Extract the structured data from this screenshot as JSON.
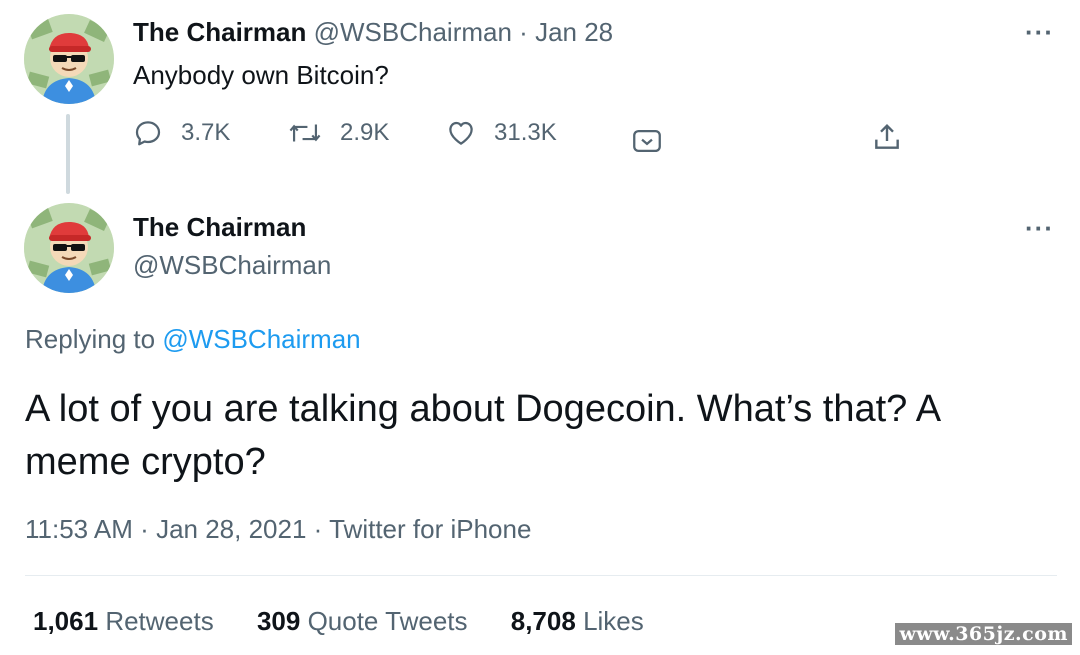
{
  "tweet1": {
    "display_name": "The Chairman",
    "handle": "@WSBChairman",
    "separator": "·",
    "date": "Jan 28",
    "text": "Anybody own Bitcoin?",
    "replies": "3.7K",
    "retweets": "2.9K",
    "likes": "31.3K",
    "icons": [
      "reply-icon",
      "retweet-icon",
      "like-icon",
      "tip-jar-icon",
      "share-icon",
      "more-icon"
    ]
  },
  "tweet2": {
    "display_name": "The Chairman",
    "handle": "@WSBChairman",
    "replying_prefix": "Replying to",
    "replying_handle": "@WSBChairman",
    "text": "A lot of you are talking about Dogecoin. What’s that? A meme crypto?",
    "time": "11:53 AM",
    "date": "Jan 28, 2021",
    "source": "Twitter for iPhone",
    "separator": "·",
    "stats": {
      "retweets_count": "1,061",
      "retweets_label": "Retweets",
      "quotes_count": "309",
      "quotes_label": "Quote Tweets",
      "likes_count": "8,708",
      "likes_label": "Likes"
    }
  },
  "more_glyph": "···",
  "watermark": "www.365jz.com",
  "colors": {
    "text": "#0f1419",
    "muted": "#536471",
    "link": "#1d9bf0",
    "divider": "#e6ecf0"
  }
}
